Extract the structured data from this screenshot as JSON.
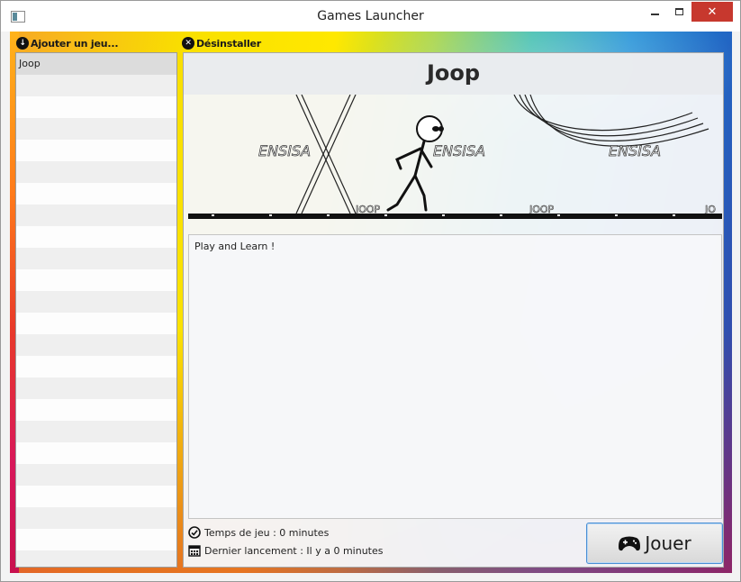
{
  "window": {
    "title": "Games Launcher",
    "close_glyph": "✕"
  },
  "toolbar": {
    "add_game_label": "Ajouter un jeu...",
    "uninstall_label": "Désinstaller",
    "add_icon": "download-icon",
    "uninstall_icon": "remove-icon"
  },
  "game_list": {
    "items": [
      "Joop"
    ],
    "selected_index": 0
  },
  "game": {
    "title": "Joop",
    "banner_texts": [
      "ENSISA",
      "ENSISA",
      "ENSISA",
      "JOOP",
      "JOOP",
      "JO"
    ],
    "description": "Play and Learn !",
    "play_time": "Temps de jeu : 0 minutes",
    "last_launch": "Dernier lancement : Il y a 0 minutes",
    "play_button_label": "Jouer"
  },
  "colors": {
    "close_button": "#c7382e",
    "play_button_border": "#4a8fd4"
  }
}
